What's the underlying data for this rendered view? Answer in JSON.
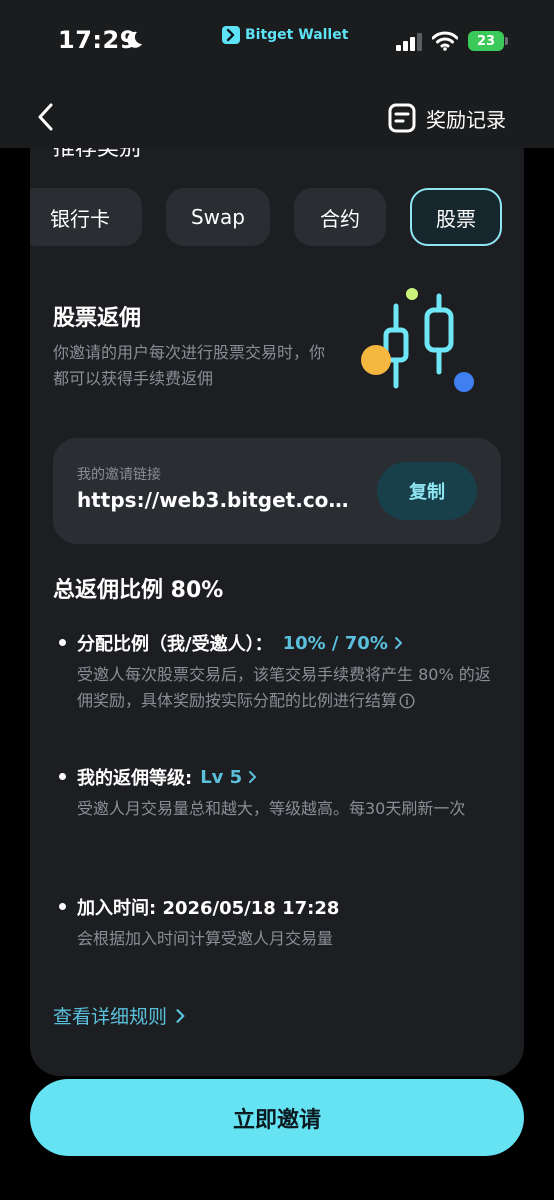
{
  "status_bar": {
    "time": "17:29",
    "brand": "Bitget Wallet",
    "battery": "23"
  },
  "nav": {
    "rewards_history_label": "奖励记录"
  },
  "section": {
    "cut_heading": "推荐类别"
  },
  "tabs": [
    {
      "label": "银行卡",
      "active": false
    },
    {
      "label": "Swap",
      "active": false
    },
    {
      "label": "合约",
      "active": false
    },
    {
      "label": "股票",
      "active": true
    }
  ],
  "feature": {
    "title": "股票返佣",
    "description": "你邀请的用户每次进行股票交易时，你都可以获得手续费返佣"
  },
  "invite_link": {
    "label": "我的邀请链接",
    "value": "https://web3.bitget.co...",
    "copy_label": "复制"
  },
  "total_rate": "总返佣比例 80%",
  "bullets": {
    "split": {
      "label": "分配比例（我/受邀人）：",
      "value": "10% / 70%",
      "description": "受邀人每次股票交易后，该笔交易手续费将产生 80% 的返佣奖励，具体奖励按实际分配的比例进行结算"
    },
    "level": {
      "label": "我的返佣等级:",
      "value": "Lv 5",
      "description": "受邀人月交易量总和越大，等级越高。每30天刷新一次"
    },
    "joined": {
      "label": "加入时间: 2026/05/18 17:28",
      "description": "会根据加入时间计算受邀人月交易量"
    }
  },
  "detail_rules_label": "查看详细规则",
  "invite_button_label": "立即邀请",
  "colors": {
    "accent": "#66e3f3",
    "link": "#5bc0dc",
    "card_bg": "#1c1e21",
    "page_bg": "#000000"
  }
}
